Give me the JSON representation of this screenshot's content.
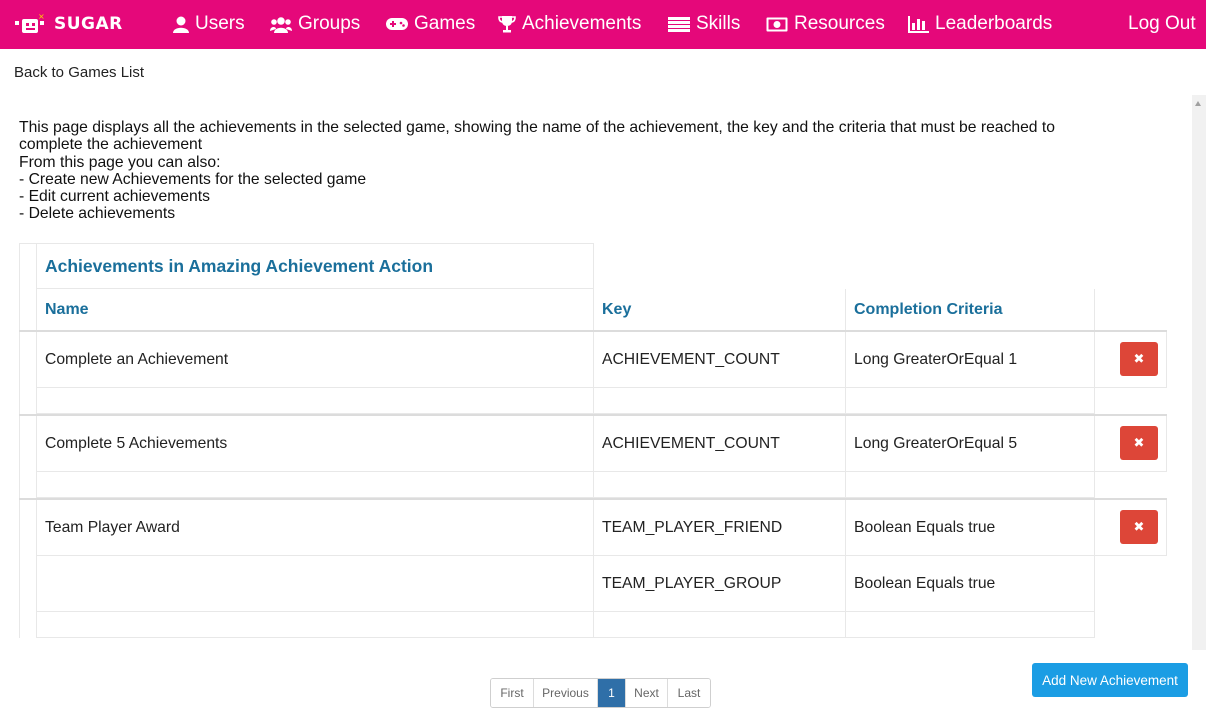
{
  "navbar": {
    "brand": "SUGAR",
    "brand_color": "#e5087a",
    "items": [
      {
        "label": "Users",
        "icon": "user-icon"
      },
      {
        "label": "Groups",
        "icon": "group-icon"
      },
      {
        "label": "Games",
        "icon": "gamepad-icon"
      },
      {
        "label": "Achievements",
        "icon": "trophy-icon"
      },
      {
        "label": "Skills",
        "icon": "list-icon"
      },
      {
        "label": "Resources",
        "icon": "money-icon"
      },
      {
        "label": "Leaderboards",
        "icon": "bar-chart-icon"
      }
    ],
    "logout": "Log Out"
  },
  "back_link": "Back to Games List",
  "description": {
    "line1": "This page displays all the achievements in the selected game, showing the name of the achievement, the key and the criteria that must be reached to",
    "line2": "complete the achievement",
    "line3": "From this page you can also:",
    "line4": "- Create new Achievements for the selected game",
    "line5": "- Edit current achievements",
    "line6": "- Delete achievements"
  },
  "table": {
    "title": "Achievements in Amazing Achievement Action",
    "columns": {
      "name": "Name",
      "key": "Key",
      "criteria": "Completion Criteria"
    },
    "rows": [
      {
        "name": "Complete an Achievement",
        "criteria": [
          {
            "key": "ACHIEVEMENT_COUNT",
            "value": "Long GreaterOrEqual 1"
          }
        ]
      },
      {
        "name": "Complete 5 Achievements",
        "criteria": [
          {
            "key": "ACHIEVEMENT_COUNT",
            "value": "Long GreaterOrEqual 5"
          }
        ]
      },
      {
        "name": "Team Player Award",
        "criteria": [
          {
            "key": "TEAM_PLAYER_FRIEND",
            "value": "Boolean Equals true"
          },
          {
            "key": "TEAM_PLAYER_GROUP",
            "value": "Boolean Equals true"
          }
        ]
      }
    ],
    "delete_color": "#dd4638",
    "delete_icon": "close-icon"
  },
  "pagination": {
    "first": "First",
    "previous": "Previous",
    "current": "1",
    "next": "Next",
    "last": "Last",
    "active_color": "#2f6fa8"
  },
  "add_button": "Add New Achievement",
  "add_button_color": "#1b9de4"
}
